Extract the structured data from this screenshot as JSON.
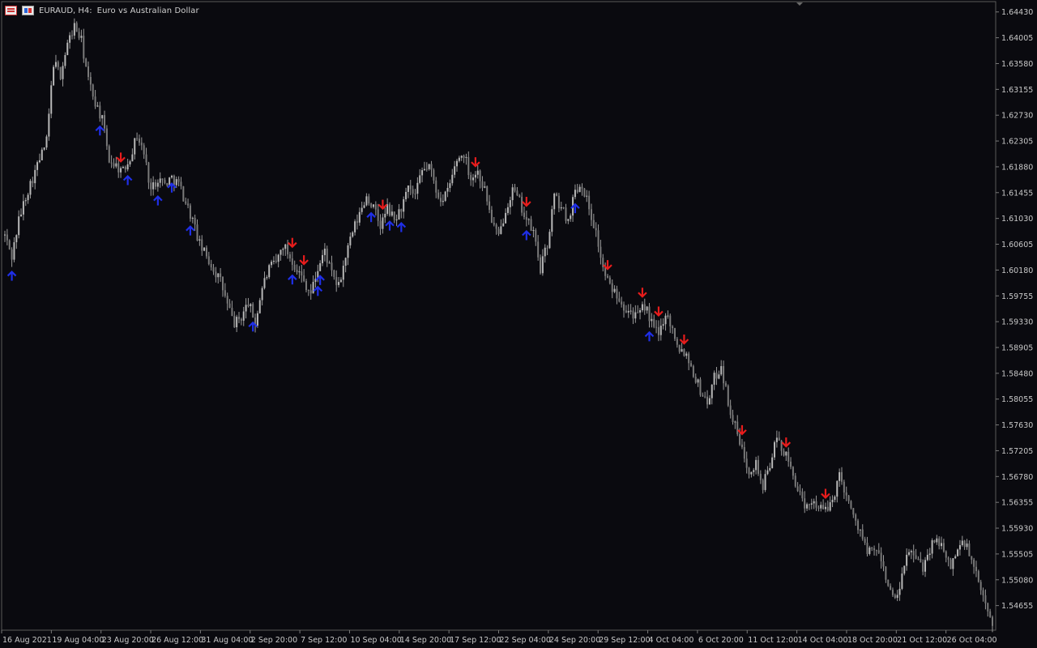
{
  "header": {
    "symbol": "EURAUD, H4:",
    "description": "Euro vs Australian Dollar",
    "icons": [
      "chart-menu-icon",
      "one-click-trading-icon"
    ]
  },
  "colors": {
    "background": "#0a0a0f",
    "candle": "#9a9a9a",
    "axis_text": "#c8c8c8",
    "up_arrow": "#1f2fe8",
    "down_arrow": "#e81c1c"
  },
  "chart_data": {
    "type": "candlestick",
    "ylim": [
      1.5425,
      1.646
    ],
    "y_ticks": [
      "1.64430",
      "1.64005",
      "1.63580",
      "1.63155",
      "1.62730",
      "1.62305",
      "1.61880",
      "1.61455",
      "1.61030",
      "1.60605",
      "1.60180",
      "1.59755",
      "1.59330",
      "1.58905",
      "1.58480",
      "1.58055",
      "1.57630",
      "1.57205",
      "1.56780",
      "1.56355",
      "1.55930",
      "1.55505",
      "1.55080",
      "1.54655"
    ],
    "x_ticks": [
      "16 Aug 2021",
      "19 Aug 04:00",
      "23 Aug 20:00",
      "26 Aug 12:00",
      "31 Aug 04:00",
      "2 Sep 20:00",
      "7 Sep 12:00",
      "10 Sep 04:00",
      "14 Sep 20:00",
      "17 Sep 12:00",
      "22 Sep 04:00",
      "24 Sep 20:00",
      "29 Sep 12:00",
      "4 Oct 04:00",
      "6 Oct 20:00",
      "11 Oct 12:00",
      "14 Oct 04:00",
      "18 Oct 20:00",
      "21 Oct 12:00",
      "26 Oct 04:00"
    ],
    "price_path": [
      [
        0,
        1.6075
      ],
      [
        3,
        1.604
      ],
      [
        6,
        1.61
      ],
      [
        9,
        1.614
      ],
      [
        12,
        1.617
      ],
      [
        15,
        1.62
      ],
      [
        18,
        1.623
      ],
      [
        21,
        1.636
      ],
      [
        24,
        1.634
      ],
      [
        27,
        1.639
      ],
      [
        30,
        1.642
      ],
      [
        33,
        1.6395
      ],
      [
        36,
        1.633
      ],
      [
        39,
        1.6295
      ],
      [
        42,
        1.6265
      ],
      [
        45,
        1.62
      ],
      [
        48,
        1.619
      ],
      [
        51,
        1.618
      ],
      [
        54,
        1.6205
      ],
      [
        57,
        1.624
      ],
      [
        60,
        1.621
      ],
      [
        63,
        1.615
      ],
      [
        66,
        1.617
      ],
      [
        69,
        1.616
      ],
      [
        72,
        1.617
      ],
      [
        75,
        1.616
      ],
      [
        78,
        1.613
      ],
      [
        81,
        1.61
      ],
      [
        84,
        1.606
      ],
      [
        87,
        1.604
      ],
      [
        90,
        1.602
      ],
      [
        93,
        1.6
      ],
      [
        96,
        1.596
      ],
      [
        99,
        1.593
      ],
      [
        102,
        1.594
      ],
      [
        105,
        1.5965
      ],
      [
        108,
        1.593
      ],
      [
        111,
        1.599
      ],
      [
        114,
        1.602
      ],
      [
        117,
        1.603
      ],
      [
        120,
        1.606
      ],
      [
        123,
        1.604
      ],
      [
        126,
        1.602
      ],
      [
        129,
        1.6
      ],
      [
        132,
        1.598
      ],
      [
        135,
        1.602
      ],
      [
        138,
        1.605
      ],
      [
        141,
        1.601
      ],
      [
        144,
        1.599
      ],
      [
        147,
        1.604
      ],
      [
        150,
        1.608
      ],
      [
        153,
        1.611
      ],
      [
        156,
        1.614
      ],
      [
        159,
        1.612
      ],
      [
        162,
        1.609
      ],
      [
        165,
        1.612
      ],
      [
        168,
        1.61
      ],
      [
        171,
        1.612
      ],
      [
        174,
        1.615
      ],
      [
        177,
        1.614
      ],
      [
        180,
        1.618
      ],
      [
        183,
        1.619
      ],
      [
        186,
        1.615
      ],
      [
        189,
        1.613
      ],
      [
        192,
        1.616
      ],
      [
        195,
        1.62
      ],
      [
        198,
        1.621
      ],
      [
        201,
        1.617
      ],
      [
        204,
        1.618
      ],
      [
        207,
        1.615
      ],
      [
        210,
        1.61
      ],
      [
        213,
        1.607
      ],
      [
        216,
        1.612
      ],
      [
        219,
        1.615
      ],
      [
        222,
        1.613
      ],
      [
        225,
        1.61
      ],
      [
        228,
        1.608
      ],
      [
        231,
        1.602
      ],
      [
        234,
        1.606
      ],
      [
        237,
        1.614
      ],
      [
        240,
        1.612
      ],
      [
        243,
        1.61
      ],
      [
        246,
        1.615
      ],
      [
        249,
        1.616
      ],
      [
        252,
        1.612
      ],
      [
        255,
        1.608
      ],
      [
        258,
        1.602
      ],
      [
        261,
        1.599
      ],
      [
        264,
        1.598
      ],
      [
        267,
        1.596
      ],
      [
        270,
        1.595
      ],
      [
        273,
        1.594
      ],
      [
        276,
        1.596
      ],
      [
        279,
        1.593
      ],
      [
        282,
        1.591
      ],
      [
        285,
        1.595
      ],
      [
        288,
        1.592
      ],
      [
        291,
        1.589
      ],
      [
        294,
        1.588
      ],
      [
        297,
        1.585
      ],
      [
        300,
        1.582
      ],
      [
        303,
        1.58
      ],
      [
        306,
        1.584
      ],
      [
        309,
        1.586
      ],
      [
        312,
        1.58
      ],
      [
        315,
        1.576
      ],
      [
        318,
        1.572
      ],
      [
        321,
        1.569
      ],
      [
        324,
        1.57
      ],
      [
        327,
        1.566
      ],
      [
        330,
        1.57
      ],
      [
        333,
        1.574
      ],
      [
        336,
        1.572
      ],
      [
        339,
        1.569
      ],
      [
        342,
        1.566
      ],
      [
        345,
        1.562
      ],
      [
        348,
        1.564
      ],
      [
        351,
        1.563
      ],
      [
        354,
        1.562
      ],
      [
        357,
        1.564
      ],
      [
        360,
        1.568
      ],
      [
        363,
        1.565
      ],
      [
        366,
        1.561
      ],
      [
        369,
        1.559
      ],
      [
        372,
        1.555
      ],
      [
        375,
        1.556
      ],
      [
        378,
        1.554
      ],
      [
        381,
        1.55
      ],
      [
        384,
        1.547
      ],
      [
        387,
        1.551
      ],
      [
        390,
        1.556
      ],
      [
        393,
        1.554
      ],
      [
        396,
        1.553
      ],
      [
        399,
        1.556
      ],
      [
        402,
        1.558
      ],
      [
        405,
        1.555
      ],
      [
        408,
        1.553
      ],
      [
        411,
        1.556
      ],
      [
        414,
        1.557
      ],
      [
        417,
        1.554
      ],
      [
        420,
        1.55
      ],
      [
        423,
        1.547
      ],
      [
        426,
        1.544
      ]
    ],
    "candle_count": 427,
    "up_arrows_at_candle": [
      3,
      120,
      155,
      194,
      210,
      232,
      311,
      359,
      389,
      394,
      455,
      480,
      494,
      648,
      708,
      799
    ],
    "down_arrows_at_candle": [
      146,
      359,
      374,
      471,
      585,
      648,
      749,
      792,
      812,
      842,
      913,
      968,
      1016
    ]
  }
}
